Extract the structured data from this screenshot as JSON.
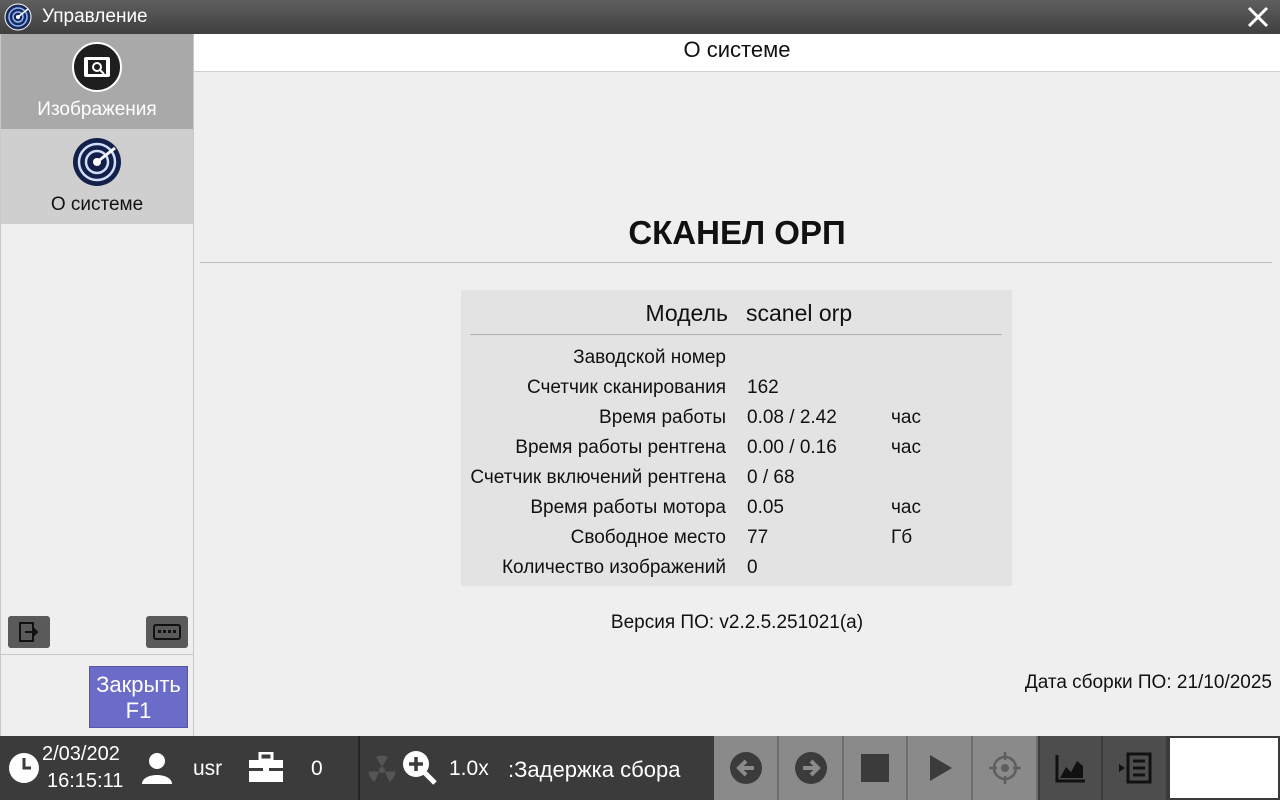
{
  "window": {
    "title": "Управление"
  },
  "sidebar": {
    "items": [
      {
        "label": "Изображения"
      },
      {
        "label": "О системе"
      }
    ],
    "close_button": {
      "line1": "Закрыть",
      "line2": "F1"
    }
  },
  "main": {
    "header": "О системе",
    "product_name": "СКАНЕЛ ОРП",
    "model_label": "Модель",
    "model_value": "scanel orp",
    "rows": [
      {
        "label": "Заводской номер",
        "value": "",
        "unit": ""
      },
      {
        "label": "Счетчик сканирования",
        "value": "162",
        "unit": ""
      },
      {
        "label": "Время работы",
        "value": "0.08 / 2.42",
        "unit": "час"
      },
      {
        "label": "Время работы рентгена",
        "value": "0.00 / 0.16",
        "unit": "час"
      },
      {
        "label": "Счетчик включений рентгена",
        "value": "0 / 68",
        "unit": ""
      },
      {
        "label": "Время работы мотора",
        "value": "0.05",
        "unit": "час"
      },
      {
        "label": "Свободное место",
        "value": "77",
        "unit": "Гб"
      },
      {
        "label": "Количество изображений",
        "value": "0",
        "unit": ""
      }
    ],
    "version": "Версия ПО: v2.2.5.251021(a)",
    "build_date": "Дата сборки ПО: 21/10/2025"
  },
  "bottombar": {
    "date": "2/03/202",
    "time": "16:15:11",
    "user": "usr",
    "case_count": "0",
    "zoom": "1.0x",
    "status": ":Задержка сбора"
  },
  "icons": {
    "app": "radar-logo-icon",
    "close": "close-icon",
    "images": "camera-icon",
    "about": "radar-logo-icon",
    "logout": "logout-icon",
    "keyboard": "keyboard-icon",
    "clock": "clock-icon",
    "user": "user-icon",
    "case": "briefcase-icon",
    "radiation": "radiation-icon",
    "zoom": "zoom-in-icon",
    "prev": "arrow-left-icon",
    "next": "arrow-right-icon",
    "stop": "stop-icon",
    "play": "play-icon",
    "target": "crosshair-icon",
    "chart": "chart-icon",
    "list": "list-icon"
  },
  "colors": {
    "accent_button": "#6b6bc8",
    "titlebar": "#4a4a4a",
    "bottombar": "#3b3b3b"
  }
}
